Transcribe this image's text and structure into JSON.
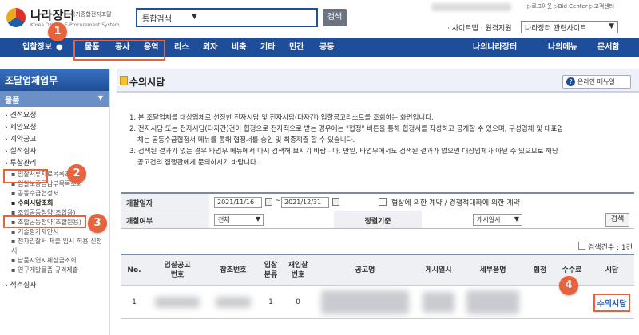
{
  "header": {
    "logo_title": "나라장터",
    "logo_sub": "국가종합전자조달",
    "logo_eng": "Korea ON-line E-Procurement System",
    "search_scope": "통합검색",
    "search_button": "검색",
    "util_links": "▷로그아웃 ▷Bid Center ▷고객센터",
    "util_row2": "· 사이트맵 · 원격지원",
    "site_select": "나라장터 관련사이트"
  },
  "nav": {
    "items": [
      "입찰정보",
      "물품",
      "공사",
      "용역",
      "리스",
      "외자",
      "비축",
      "기타",
      "민간",
      "공동",
      "나의나라장터",
      "나의메뉴",
      "문서함"
    ]
  },
  "sidebar": {
    "title": "조달업체업무",
    "category": "물품",
    "items": [
      "견적요청",
      "제안요청",
      "계약공고",
      "실적심사"
    ],
    "group_label": "투찰관리",
    "subitems": [
      "입찰서류자료목록조회",
      "입찰보증금납부목록조회",
      "공동수급협정서",
      "수의시담조회",
      "조합공동청약(조합용)",
      "조합공동청약(조합원용)",
      "기술평가제안서",
      "전자입찰서 제출 임시 허용 신청서",
      "납품지연지체상금조회",
      "연구개발물품 규격제출"
    ],
    "bottom_item": "적격심사"
  },
  "main": {
    "title": "수의시담",
    "manual_button": "온라인 매뉴얼",
    "notes": [
      "1. 본 조달업체를 대상업체로 선정한 전자시담 및 전자시담(다자간) 입찰공고리스트를 조회하는 화면입니다.",
      "2. 전자시담 또는 전자시담(다자간)건이 협정으로 전자적으로 받는 경우에는 \"협정\" 버튼을 통해 협정서를 작성하고 공개할 수 있으며, 구성업체 및 대표업",
      "체는 공동수급협정서 메뉴를 통해 협정서를 승인 및 최종제출 할 수 있습니다.",
      "3. 검색된 결과가 없는 경우 타업무 메뉴에서 다시 검색해 보시기 바랍니다. 만일, 타업무에서도 검색된 결과가 없으면 대상업체가 아닐 수 있으므로 해당",
      "공고건의 집행관에게 문의하시기 바랍니다."
    ]
  },
  "filter": {
    "date_label": "개찰일자",
    "date_from": "2021/11/16",
    "date_sep": "~",
    "date_to": "2021/12/31",
    "checkbox_label": "협상에 의한 계약 / 경쟁적대화에 의한 계약",
    "status_label": "개찰여부",
    "status_value": "전체",
    "sort_label": "정렬기준",
    "sort_value": "게시일시",
    "search_button": "검색"
  },
  "result_count": "검색건수 : 1건",
  "table": {
    "headers": [
      "No.",
      "입찰공고\n번호",
      "참조번호",
      "입찰\n분류",
      "재입찰\n번호",
      "공고명",
      "게시일시",
      "세부품명",
      "협정",
      "수수료",
      "시담"
    ],
    "rows": [
      {
        "no": "1",
        "type": "1",
        "rebid": "0",
        "action": "수의시담"
      }
    ]
  },
  "annotations": [
    "1",
    "2",
    "3",
    "4"
  ],
  "colors": {
    "nav": "#1e4e9a",
    "highlight": "#e8623c",
    "link": "#1a5bb8"
  }
}
